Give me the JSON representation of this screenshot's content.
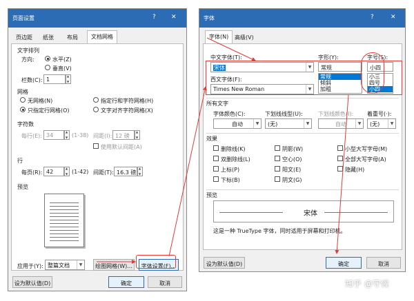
{
  "left_dialog": {
    "title": "页面设置",
    "help": "?",
    "close": "✕",
    "tabs": [
      "页边距",
      "纸张",
      "布局",
      "文档网格"
    ],
    "text_direction": {
      "header": "文字排列",
      "direction_label": "方向:",
      "horizontal": "水平(Z)",
      "vertical": "垂直(V)",
      "columns_label": "栏数(C):",
      "columns_value": "1"
    },
    "grid": {
      "header": "网格",
      "no_grid": "无网格(N)",
      "char_and_line": "指定行和字符网格(H)",
      "line_only": "只指定行网格(O)",
      "snap_to_chars": "文字对齐字符网格(X)"
    },
    "chars": {
      "header": "字符数",
      "per_line_label": "每行(E):",
      "per_line_value": "34",
      "per_line_range": "(1-38)",
      "pitch_label": "间距(I):",
      "pitch_value": "12 磅",
      "use_default": "使用默认间距(A)"
    },
    "lines": {
      "header": "行",
      "per_page_label": "每页(R):",
      "per_page_value": "42",
      "per_page_range": "(1-42)",
      "pitch_label": "间距(T):",
      "pitch_value": "16.3 磅"
    },
    "preview": {
      "header": "预览"
    },
    "apply": {
      "label": "应用于(Y):",
      "value": "整篇文档"
    },
    "draw_grid": "绘图网格(W)...",
    "font_settings": "字体设置(F)...",
    "set_default": "设为默认值(D)",
    "ok": "确定",
    "cancel": "取消"
  },
  "right_dialog": {
    "title": "字体",
    "help": "?",
    "close": "✕",
    "tabs": [
      "字体(N)",
      "高级(V)"
    ],
    "asian_font": {
      "label": "中文字体(T):",
      "value": "宋体"
    },
    "latin_font": {
      "label": "西文字体(F):",
      "value": "Times New Roman"
    },
    "style": {
      "label": "字形(Y):",
      "value": "常规",
      "options": [
        "常规",
        "倾斜",
        "加粗"
      ]
    },
    "size": {
      "label": "字号(S):",
      "value": "小四",
      "options": [
        "小三",
        "四号",
        "小四"
      ]
    },
    "all_text": {
      "header": "所有文字",
      "color_label": "字体颜色(C):",
      "color_value": "自动",
      "underline_label": "下划线线型(U):",
      "underline_value": "(无)",
      "underline_color_label": "下划线颜色(I):",
      "underline_color_value": "自动",
      "emphasis_label": "着重号(·):",
      "emphasis_value": "(无)"
    },
    "effects": {
      "header": "效果",
      "items": [
        "删除线(K)",
        "阴影(W)",
        "小型大写字母(M)",
        "双删除线(L)",
        "空心(O)",
        "全部大写字母(A)",
        "上标(P)",
        "阳文(E)",
        "隐藏(H)",
        "下标(B)",
        "阴文(G)"
      ]
    },
    "preview": {
      "header": "预览",
      "sample": "宋体",
      "note": "这是一种 TrueType 字体，同时适用于屏幕和打印机。"
    },
    "set_default": "设为默认值(D)",
    "ok": "确定",
    "cancel": "取消"
  },
  "watermark": "知乎 @守候",
  "colors": {
    "titlebar": "#2b6cb5",
    "annotation": "#e53935",
    "selection": "#0078d7"
  }
}
